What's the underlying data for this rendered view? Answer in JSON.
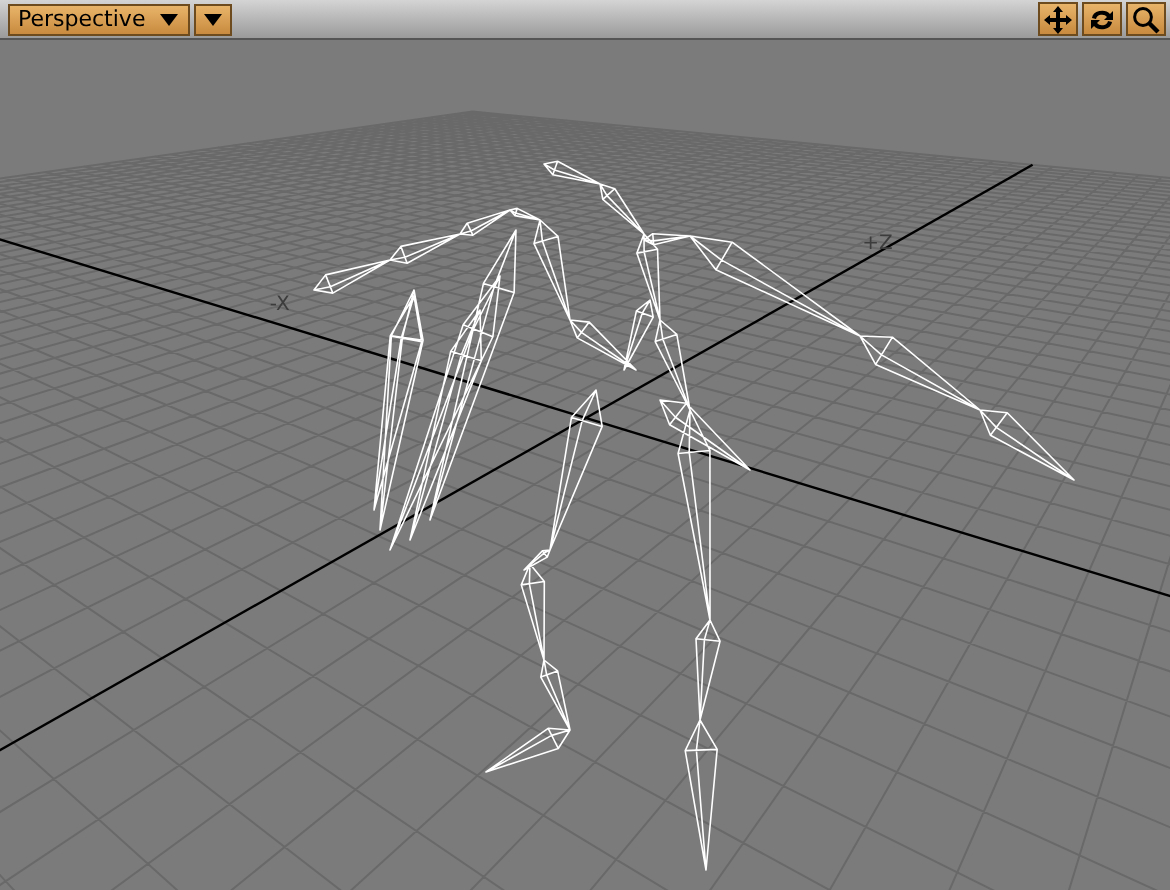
{
  "viewport_header": {
    "view_menu": {
      "label": "Perspective"
    }
  },
  "axis_labels": [
    {
      "kind": "x",
      "text": "-X"
    },
    {
      "kind": "z",
      "text": "+Z"
    }
  ]
}
